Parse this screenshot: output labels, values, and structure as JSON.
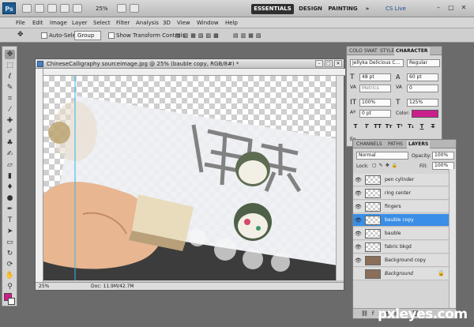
{
  "app": {
    "logo": "Ps",
    "zoom": "25%",
    "workspaces": [
      "ESSENTIALS",
      "DESIGN",
      "PAINTING",
      "»"
    ],
    "cs_live": "CS Live",
    "window_controls": [
      "–",
      "□",
      "✕"
    ]
  },
  "menu": [
    "File",
    "Edit",
    "Image",
    "Layer",
    "Select",
    "Filter",
    "Analysis",
    "3D",
    "View",
    "Window",
    "Help"
  ],
  "options": {
    "auto_select_label": "Auto-Select:",
    "auto_select_value": "Group",
    "show_transform_label": "Show Transform Controls"
  },
  "document": {
    "title": "ChineseCalligraphy sourceimage.jpg @ 25% (bauble copy, RGB/8#) *",
    "zoom": "25%",
    "doc_info": "Doc: 11.9M/42.7M",
    "canvas_text": "保是六"
  },
  "character_panel": {
    "tabs": [
      "COLO",
      "SWAT",
      "STYLE",
      "CHARACTER"
    ],
    "font_family": "Jellyka Delicious C...",
    "font_style": "Regular",
    "size": "48 pt",
    "leading": "60 pt",
    "kerning": "Metrics",
    "tracking": "0",
    "vscale": "100%",
    "hscale": "125%",
    "baseline": "0 pt",
    "color_label": "Color:",
    "color": "#cc1f8e",
    "format_buttons": [
      "T",
      "T",
      "TT",
      "Tт",
      "T¹",
      "T₁",
      "T",
      "T"
    ],
    "language": "En"
  },
  "layers_panel": {
    "tabs": [
      "CHANNELS",
      "PATHS",
      "LAYERS"
    ],
    "blend_mode": "Normal",
    "opacity_label": "Opacity:",
    "opacity": "100%",
    "lock_label": "Lock:",
    "fill_label": "Fill:",
    "fill": "100%",
    "layers": [
      {
        "name": "pen cylinder",
        "selected": false,
        "visible": true
      },
      {
        "name": "ring center",
        "selected": false,
        "visible": true
      },
      {
        "name": "fingers",
        "selected": false,
        "visible": true
      },
      {
        "name": "bauble copy",
        "selected": true,
        "visible": true
      },
      {
        "name": "bauble",
        "selected": false,
        "visible": true
      },
      {
        "name": "fabric bkgd",
        "selected": false,
        "visible": true
      },
      {
        "name": "Background copy",
        "selected": false,
        "visible": true
      },
      {
        "name": "Background",
        "selected": false,
        "visible": false
      }
    ]
  },
  "toolbox": {
    "foreground": "#d21b8c",
    "background": "#ffffff"
  },
  "watermark": "pxleyes.com"
}
